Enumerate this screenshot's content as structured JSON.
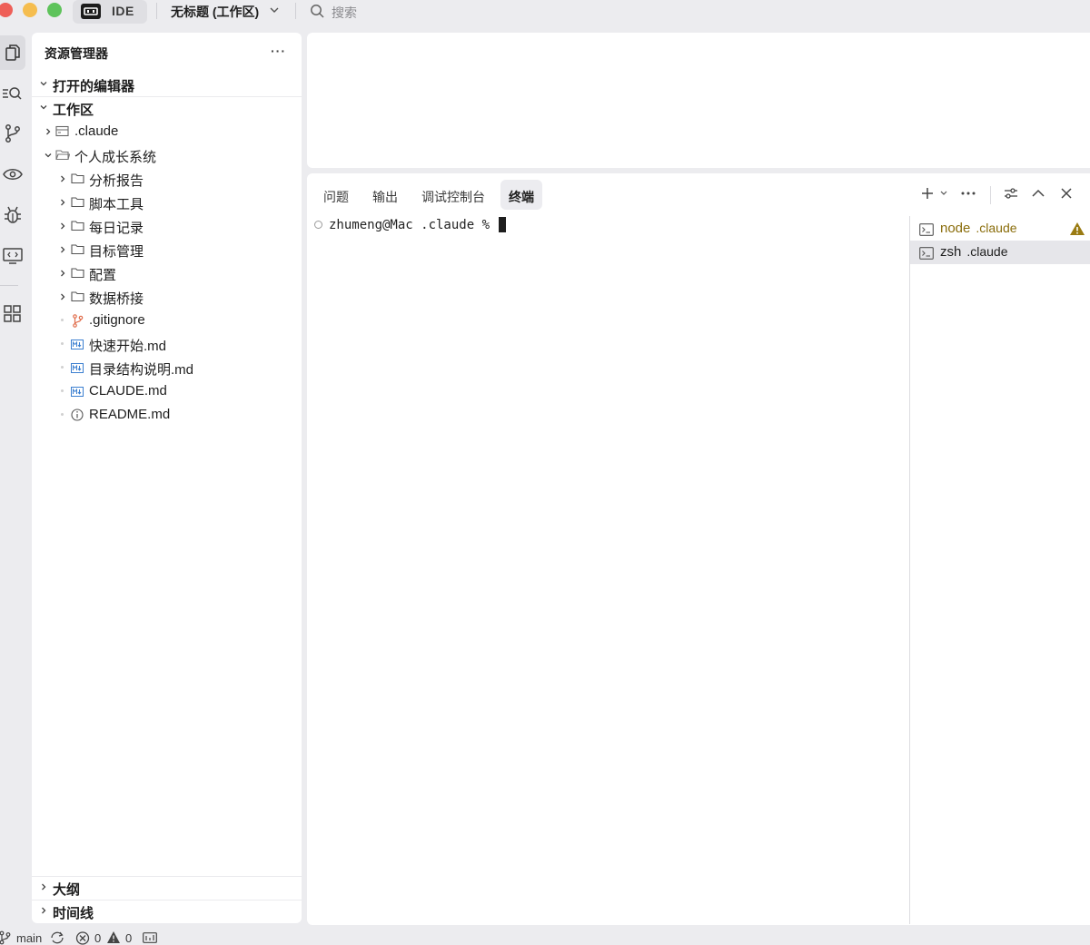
{
  "titlebar": {
    "app_tab": "IDE",
    "workspace_title": "无标题 (工作区)",
    "search_label": "搜索"
  },
  "sidebar": {
    "title": "资源管理器",
    "more": "···",
    "sections": {
      "open_editors": "打开的编辑器",
      "workspace": "工作区",
      "outline": "大纲",
      "timeline": "时间线"
    },
    "tree": [
      {
        "name": ".claude",
        "kind": "root-folder",
        "expanded": false
      },
      {
        "name": "个人成长系统",
        "kind": "root-folder",
        "expanded": true
      },
      {
        "name": "分析报告",
        "kind": "folder"
      },
      {
        "name": "脚本工具",
        "kind": "folder"
      },
      {
        "name": "每日记录",
        "kind": "folder"
      },
      {
        "name": "目标管理",
        "kind": "folder"
      },
      {
        "name": "配置",
        "kind": "folder"
      },
      {
        "name": "数据桥接",
        "kind": "folder"
      },
      {
        "name": ".gitignore",
        "kind": "git-file"
      },
      {
        "name": "快速开始.md",
        "kind": "markdown-file"
      },
      {
        "name": "目录结构说明.md",
        "kind": "markdown-file"
      },
      {
        "name": "CLAUDE.md",
        "kind": "markdown-file"
      },
      {
        "name": "README.md",
        "kind": "info-file"
      }
    ]
  },
  "panel": {
    "tabs": [
      "问题",
      "输出",
      "调试控制台",
      "终端"
    ],
    "active_tab": "终端",
    "terminal": {
      "prompt": "zhumeng@Mac .claude % "
    },
    "terminal_list": [
      {
        "name": "node",
        "dir": ".claude",
        "warning": true,
        "selected": false
      },
      {
        "name": "zsh",
        "dir": ".claude",
        "warning": false,
        "selected": true
      }
    ]
  },
  "statusbar": {
    "branch": "main",
    "errors": "0",
    "warnings": "0"
  },
  "colors": {
    "warning_text": "#8a6d0b",
    "git_icon": "#e06c4a",
    "markdown_icon": "#3b7fd0"
  }
}
